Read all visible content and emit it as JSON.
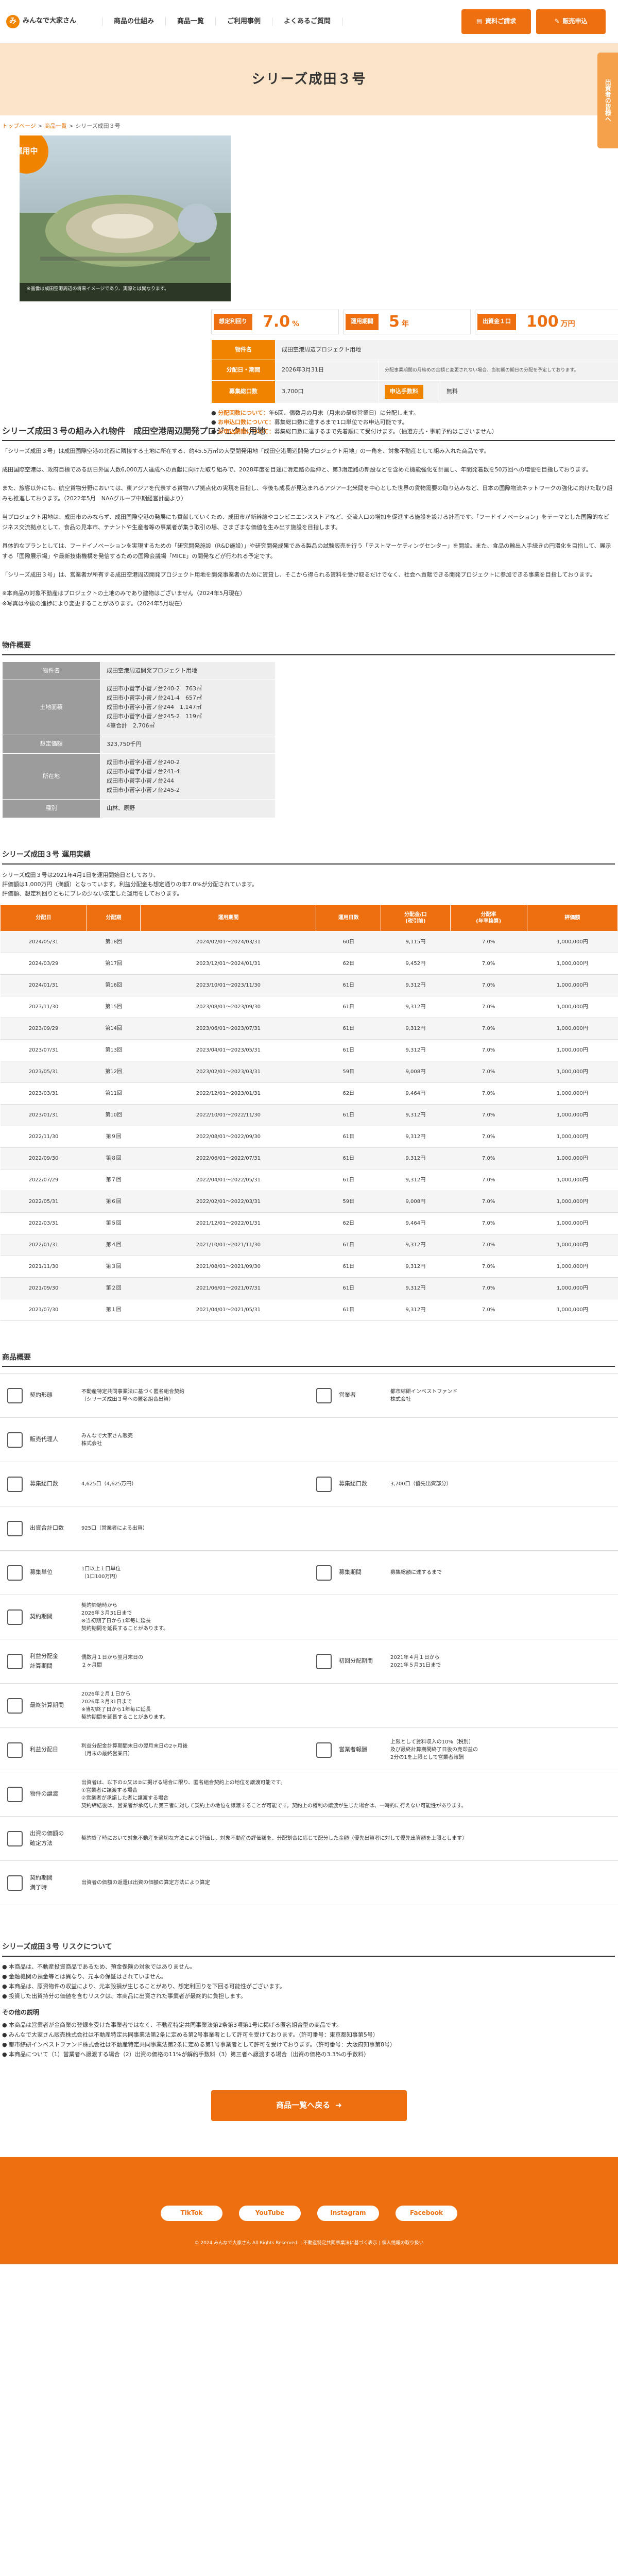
{
  "header": {
    "logo_mark": "み",
    "logo_text": "みんなで大家さん",
    "nav": [
      "商品の仕組み",
      "商品一覧",
      "ご利用事例",
      "よくあるご質問"
    ],
    "btn_doc": "資料ご請求",
    "btn_apply": "販売申込"
  },
  "side_tab": "出資者の皆様へ",
  "hero_title": "シリーズ成田３号",
  "breadcrumb": {
    "home": "トップページ",
    "list": "商品一覧",
    "current": "シリーズ成田３号"
  },
  "photo_badge": "運用中",
  "photo_caption": "※画像は成田空港周辺の将来イメージであり、実際とは異なります。",
  "rates": [
    {
      "label": "想定利回り",
      "value": "7.0",
      "unit": "%"
    },
    {
      "label": "運用期間",
      "value": "5",
      "unit": "年"
    },
    {
      "label": "出資金１口",
      "value": "100",
      "unit": "万円"
    }
  ],
  "ptable": {
    "name_label": "物件名",
    "name": "成田空港周辺プロジェクト用地",
    "period_label": "分配日・期間",
    "period": "2026年3月31日",
    "period_note": "分配事業期間の月締めの金額と変更されない場合、当初期の期日の分配を予定しております。",
    "amount_label": "募集総口数",
    "amount": "3,700口",
    "fee_label": "申込手数料",
    "fee": "無料"
  },
  "notes": [
    {
      "k": "分配回数について：",
      "v": "年6回、偶数月の月末（月末の最終営業日）に分配します。"
    },
    {
      "k": "お申込口数について：",
      "v": "募集総口数に達するまで1口単位でお申込可能です。"
    },
    {
      "k": "お申込期間について：",
      "v": "募集総口数に達するまで先着順にて受付けます。（抽選方式・事前予約はございません）"
    }
  ],
  "intro": {
    "title": "シリーズ成田３号の組み入れ物件　成田空港周辺開発プロジェクト用地",
    "p1": "「シリーズ成田３号」は成田国際空港の北西に隣接する土地に所在する、約45.5万㎡の大型開発用地「成田空港周辺開発プロジェクト用地」の一角を、対象不動産として組み入れた商品です。",
    "p2": "成田国際空港は、政府目標である訪日外国人数6,000万人達成への貢献に向けた取り組みで、2028年度を目途に滑走路の延伸と、第3滑走路の新設などを含めた機能強化を計画し、年間発着数を50万回への増便を目指しております。",
    "p3": "また、旅客以外にも、航空貨物分野においては、東アジアを代表する貨物ハブ拠点化の実現を目指し、今後も成長が見込まれるアジアー北米間を中心とした世界の貨物需要の取り込みなど、日本の国際物流ネットワークの強化に向けた取り組みも推進しております。（2022年5月　NAAグループ中期経営計画より）",
    "p4": "当プロジェクト用地は、成田市のみならず、成田国際空港の発展にも貢献していくため、成田市が新幹線やコンビニエンスストアなど、交流人口の増加を促進する施設を設ける計画です。「フードイノベーション」をテーマとした国際的なビジネス交流拠点として、食品の見本市、テナントや生産者等の事業者が集う取引の場、さまざまな価値を生み出す施設を目指します。",
    "p5": "具体的なプランとしては、フードイノベーションを実現するための「研究開発施設（R&D施設）」や研究開発成果である製品の試験販売を行う「テストマーケティングセンター」を開設。また、食品の輸出入手続きの円滑化を目指して、展示する「国際展示場」や最新技術機構を発信するための国際会議場「MICE」の開発などが行われる予定です。",
    "p6": "「シリーズ成田３号」は、営業者が所有する成田空港周辺開発プロジェクト用地を開発事業者のために賃貸し、そこから得られる賃料を受け取るだけでなく、社会へ貢献できる開発プロジェクトに参加できる事業を目指しております。",
    "p7": "※本商品の対象不動産はプロジェクトの土地のみであり建物はございません（2024年5月現在）\n※写真は今後の進捗により変更することがあります。（2024年5月現在）"
  },
  "overview": {
    "title": "物件概要",
    "rows": [
      {
        "k": "物件名",
        "v": "成田空港周辺開発プロジェクト用地"
      },
      {
        "k": "土地面積",
        "v": "成田市小菅字小菅ノ台240-2　763㎡\n成田市小菅字小菅ノ台241-4　657㎡\n成田市小菅字小菅ノ台244　1,147㎡\n成田市小菅字小菅ノ台245-2　119㎡\n4筆合計　2,706㎡"
      },
      {
        "k": "想定価額",
        "v": "323,750千円"
      },
      {
        "k": "所在地",
        "v": "成田市小菅字小菅ノ台240-2\n成田市小菅字小菅ノ台241-4\n成田市小菅字小菅ノ台244\n成田市小菅字小菅ノ台245-2"
      },
      {
        "k": "種別",
        "v": "山林、原野"
      }
    ]
  },
  "results": {
    "title": "シリーズ成田３号 運用実績",
    "intro": "シリーズ成田３号は2021年4月1日を運用開始日としており、\n評価額は1,000万円（満額）となっています。利益分配金も想定通りの年7.0%が分配されています。\n評価額、想定利回りともにブレの少ない安定した運用をしております。",
    "headers": [
      "分配日",
      "分配期",
      "運用期間",
      "運用日数",
      "分配金/口\n(税引前)",
      "分配率\n(年率換算)",
      "評価額"
    ],
    "rows": [
      [
        "2024/05/31",
        "第18回",
        "2024/02/01～2024/03/31",
        "60日",
        "9,115円",
        "7.0%",
        "1,000,000円"
      ],
      [
        "2024/03/29",
        "第17回",
        "2023/12/01～2024/01/31",
        "62日",
        "9,452円",
        "7.0%",
        "1,000,000円"
      ],
      [
        "2024/01/31",
        "第16回",
        "2023/10/01～2023/11/30",
        "61日",
        "9,312円",
        "7.0%",
        "1,000,000円"
      ],
      [
        "2023/11/30",
        "第15回",
        "2023/08/01～2023/09/30",
        "61日",
        "9,312円",
        "7.0%",
        "1,000,000円"
      ],
      [
        "2023/09/29",
        "第14回",
        "2023/06/01～2023/07/31",
        "61日",
        "9,312円",
        "7.0%",
        "1,000,000円"
      ],
      [
        "2023/07/31",
        "第13回",
        "2023/04/01～2023/05/31",
        "61日",
        "9,312円",
        "7.0%",
        "1,000,000円"
      ],
      [
        "2023/05/31",
        "第12回",
        "2023/02/01～2023/03/31",
        "59日",
        "9,008円",
        "7.0%",
        "1,000,000円"
      ],
      [
        "2023/03/31",
        "第11回",
        "2022/12/01～2023/01/31",
        "62日",
        "9,464円",
        "7.0%",
        "1,000,000円"
      ],
      [
        "2023/01/31",
        "第10回",
        "2022/10/01～2022/11/30",
        "61日",
        "9,312円",
        "7.0%",
        "1,000,000円"
      ],
      [
        "2022/11/30",
        "第９回",
        "2022/08/01～2022/09/30",
        "61日",
        "9,312円",
        "7.0%",
        "1,000,000円"
      ],
      [
        "2022/09/30",
        "第８回",
        "2022/06/01～2022/07/31",
        "61日",
        "9,312円",
        "7.0%",
        "1,000,000円"
      ],
      [
        "2022/07/29",
        "第７回",
        "2022/04/01～2022/05/31",
        "61日",
        "9,312円",
        "7.0%",
        "1,000,000円"
      ],
      [
        "2022/05/31",
        "第６回",
        "2022/02/01～2022/03/31",
        "59日",
        "9,008円",
        "7.0%",
        "1,000,000円"
      ],
      [
        "2022/03/31",
        "第５回",
        "2021/12/01～2022/01/31",
        "62日",
        "9,464円",
        "7.0%",
        "1,000,000円"
      ],
      [
        "2022/01/31",
        "第４回",
        "2021/10/01～2021/11/30",
        "61日",
        "9,312円",
        "7.0%",
        "1,000,000円"
      ],
      [
        "2021/11/30",
        "第３回",
        "2021/08/01～2021/09/30",
        "61日",
        "9,312円",
        "7.0%",
        "1,000,000円"
      ],
      [
        "2021/09/30",
        "第２回",
        "2021/06/01～2021/07/31",
        "61日",
        "9,312円",
        "7.0%",
        "1,000,000円"
      ],
      [
        "2021/07/30",
        "第１回",
        "2021/04/01～2021/05/31",
        "61日",
        "9,312円",
        "7.0%",
        "1,000,000円"
      ]
    ]
  },
  "product": {
    "title": "商品概要",
    "rows": [
      [
        {
          "k": "契約形態",
          "v": "不動産特定共同事業法に基づく匿名組合契約\n（シリーズ成田３号への匿名組合出資）"
        },
        {
          "k": "営業者",
          "v": "都市綜研インベストファンド\n株式会社"
        }
      ],
      [
        {
          "k": "販売代理人",
          "v": "みんなで大家さん販売\n株式会社"
        }
      ],
      [
        {
          "k": "募集総口数",
          "v": "4,625口（4,625万円）"
        },
        {
          "k": "募集総口数",
          "v": "3,700口（優先出資部分）"
        }
      ],
      [
        {
          "k": "出資合計口数",
          "v": "925口（営業者による出資）"
        }
      ],
      [
        {
          "k": "募集単位",
          "v": "1口以上１口単位\n（1口100万円）"
        },
        {
          "k": "募集期間",
          "v": "募集総額に達するまで"
        }
      ],
      [
        {
          "k": "契約期間",
          "v": "契約締結時から\n2026年３月31日まで\n※当初期了日から1年毎に延長\n契約期間を延長することがあります。"
        }
      ],
      [
        {
          "k": "利益分配金\n計算期間",
          "v": "偶数月１日から翌月末日の\n２ヶ月間"
        },
        {
          "k": "初回分配期間",
          "v": "2021年４月１日から\n2021年５月31日まで"
        }
      ],
      [
        {
          "k": "最終計算期間",
          "v": "2026年２月１日から\n2026年３月31日まで\n※当初終了日から1年毎に延長\n契約期間を延長することがあります。"
        }
      ],
      [
        {
          "k": "利益分配日",
          "v": "利益分配金計算期間末日の翌月末日の2ヶ月後\n（月末の最終営業日）"
        },
        {
          "k": "営業者報酬",
          "v": "上限として賃料収入の10%（税別）\n及び最終計算期間終了日後の売却益の\n2分の1を上限として営業者報酬"
        }
      ],
      [
        {
          "k": "物件の譲渡",
          "v": "出資者は、以下の①又は②に掲げる場合に限り、匿名組合契約上の地位を譲渡可能です。\n①営業者に譲渡する場合\n②営業者が承諾した者に譲渡する場合\n契約締結後は、営業者が承諾した第三者に対して契約上の地位を譲渡することが可能です。契約上の権利の譲渡が生じた場合は、一時的に行えない可能性があります。"
        }
      ],
      [
        {
          "k": "出資の価額の\n確定方法",
          "v": "契約終了時において対象不動産を適切な方法により評価し、対象不動産の評価額を、分配割合に応じて配分した金額（優先出資者に対して優先出資額を上限とします）"
        }
      ],
      [
        {
          "k": "契約期間\n満了時",
          "v": "出資者の価額の返還は出資の価額の算定方法により算定"
        }
      ]
    ]
  },
  "risks": {
    "title": "シリーズ成田３号 リスクについて",
    "items": [
      "本商品は、不動産投資商品であるため、預金保険の対象ではありません。",
      "金融機関の預金等とは異なり、元本の保証はされていません。",
      "本商品は、原資物件の収益により、元本毀損が生じることがあり、想定利回りを下回る可能性がございます。",
      "投資した出資持分の価値を含むリスクは、本商品に出資された事業者が最終的に負担します。"
    ],
    "sub_title": "その他の説明",
    "sub_items": [
      "本商品は営業者が金商業の登録を受けた事業者ではなく、不動産特定共同事業法第2条第3項第1号に掲げる匿名組合型の商品です。",
      "みんなで大家さん販売株式会社は不動産特定共同事業法第2条に定める第2号事業者として許可を受けております。（許可番号：東京都知事第5号）",
      "都市綜研インベストファンド株式会社は不動産特定共同事業法第2条に定める第1号事業者として許可を受けております。（許可番号：大阪府知事第8号）",
      "本商品について（1）営業者へ譲渡する場合（2）出資の価格の11%が解約手数料（3）第三者へ譲渡する場合（出資の価格の3.3%の手数料）"
    ]
  },
  "back_btn": "商品一覧へ戻る",
  "footer": {
    "sns": [
      "TikTok",
      "YouTube",
      "Instagram",
      "Facebook"
    ],
    "copy": "© 2024 みんなで大家さん All Rights Reserved. | 不動産特定共同事業法に基づく表示 | 個人情報の取り扱い"
  }
}
